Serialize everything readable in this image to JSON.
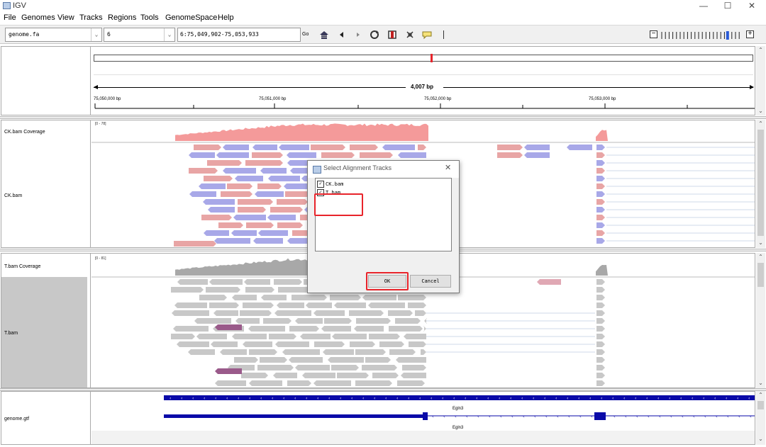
{
  "window": {
    "title": "IGV",
    "minimize_glyph": "—",
    "maximize_glyph": "☐",
    "close_glyph": "✕"
  },
  "menu": [
    "File",
    "Genomes",
    "View",
    "Tracks",
    "Regions",
    "Tools",
    "GenomeSpace",
    "Help"
  ],
  "toolbar": {
    "genome": "genome.fa",
    "chromosome": "6",
    "locus": "6:75,049,902-75,053,933",
    "go_label": "Go",
    "icons": [
      "home-icon",
      "back-icon",
      "forward-icon",
      "refresh-icon",
      "roi-icon",
      "resize-icon",
      "popup-icon"
    ],
    "zoom_level": 0.85
  },
  "ruler": {
    "span": "4,007 bp",
    "ticks": [
      "75,050,000 bp",
      "75,051,000 bp",
      "75,052,000 bp",
      "75,053,000 bp"
    ]
  },
  "tracks": {
    "ck_coverage": {
      "name": "CK.bam Coverage",
      "range": "[0 - 78]"
    },
    "ck_bam": {
      "name": "CK.bam"
    },
    "t_coverage": {
      "name": "T.bam Coverage",
      "range": "[0 - 81]"
    },
    "t_bam": {
      "name": "T.bam"
    },
    "gtf": {
      "name": "genome.gtf",
      "gene_labels": [
        "Egln3",
        "Egln3"
      ]
    }
  },
  "dialog": {
    "title": "Select Alignment Tracks",
    "items": [
      {
        "label": "CK.bam",
        "checked": true
      },
      {
        "label": "T.bam",
        "checked": true
      }
    ],
    "ok_label": "OK",
    "cancel_label": "Cancel"
  },
  "colors": {
    "forward_read": "#e8a5a5",
    "reverse_read": "#a8a8e8",
    "ck_coverage": "#f49a9a",
    "t_coverage": "#a8a8a8",
    "gray_read": "#c8c8c8",
    "gene": "#0a0aa8",
    "highlight": "#e8242b"
  }
}
